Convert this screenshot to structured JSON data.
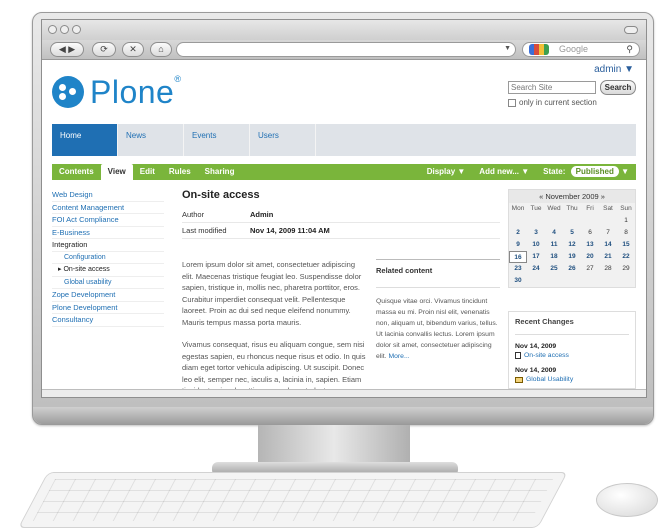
{
  "browser": {
    "search_placeholder": "Google"
  },
  "site": {
    "admin_label": "admin ▼",
    "logo_text": "Plone",
    "logo_mark": "®",
    "search_placeholder": "Search Site",
    "search_button": "Search",
    "only_current": "only in current section"
  },
  "globalnav": [
    "Home",
    "News",
    "Events",
    "Users"
  ],
  "edit_bar": {
    "tabs": [
      "Contents",
      "View",
      "Edit",
      "Rules",
      "Sharing"
    ],
    "display": "Display ▼",
    "add_new": "Add new... ▼",
    "state_label": "State:",
    "state_value": "Published",
    "state_arrow": "▼"
  },
  "sidebar": {
    "items": [
      {
        "label": "Web Design"
      },
      {
        "label": "Content Management"
      },
      {
        "label": "FOI Act Compliance"
      },
      {
        "label": "E-Business"
      },
      {
        "label": "Integration"
      },
      {
        "label": "Configuration"
      },
      {
        "label": "▸ On-site access"
      },
      {
        "label": "Global usability"
      },
      {
        "label": "Zope Development"
      },
      {
        "label": "Plone Development"
      },
      {
        "label": "Consultancy"
      }
    ]
  },
  "main": {
    "title": "On-site access",
    "author_label": "Author",
    "author_value": "Admin",
    "modified_label": "Last modified",
    "modified_value": "Nov 14, 2009 11:04 AM",
    "para1": "Lorem ipsum dolor sit amet, consectetuer adipiscing elit. Maecenas tristique feugiat leo. Suspendisse dolor sapien, tristique in, mollis nec, pharetra porttitor, eros. Curabitur imperdiet consequat velit. Pellentesque laoreet. Proin ac dui sed neque eleifend nonummy. Mauris tempus massa porta mauris.",
    "para2": "Vivamus consequat, risus eu aliquam congue, sem nisi egestas sapien, eu rhoncus neque risus et odio. In quis diam eget tortor vehicula adipiscing. Ut suscipit. Donec leo elit, semper nec, iaculis a, lacinia in, sapien. Etiam tincidunt, mi sed mattis commodo, ante lectus ornare nulla, pellentesque mollis elit"
  },
  "related": {
    "title": "Related content",
    "text": "Quisque vitae orci. Vivamus tincidunt massa eu mi. Proin nisl elit, venenatis non, aliquam ut, bibendum varius, tellus. Ut lacinia convallis lectus. Lorem ipsum dolor sit amet, consectetuer adipiscing elit.",
    "more": "More..."
  },
  "calendar": {
    "header": "« November 2009 »",
    "daynames": [
      "Mon",
      "Tue",
      "Wed",
      "Thu",
      "Fri",
      "Sat",
      "Sun"
    ],
    "rows": [
      [
        "",
        "",
        "",
        "",
        "",
        "",
        "1"
      ],
      [
        "2",
        "3",
        "4",
        "5",
        "6",
        "7",
        "8"
      ],
      [
        "9",
        "10",
        "11",
        "12",
        "13",
        "14",
        "15"
      ],
      [
        "16",
        "17",
        "18",
        "19",
        "20",
        "21",
        "22"
      ],
      [
        "23",
        "24",
        "25",
        "26",
        "27",
        "28",
        "29"
      ],
      [
        "30",
        "",
        "",
        "",
        "",
        "",
        ""
      ]
    ],
    "bold_days": [
      "2",
      "3",
      "4",
      "5",
      "9",
      "10",
      "11",
      "12",
      "13",
      "14",
      "15",
      "16",
      "17",
      "18",
      "19",
      "20",
      "21",
      "22",
      "23",
      "24",
      "25",
      "26",
      "30"
    ],
    "today": "16"
  },
  "recent": {
    "title": "Recent Changes",
    "items": [
      {
        "date": "Nov 14, 2009",
        "label": "On-site access",
        "icon": "document-icon"
      },
      {
        "date": "Nov 14, 2009",
        "label": "Global Usability",
        "icon": "folder-icon"
      }
    ]
  },
  "colors": {
    "brand_blue": "#1f84c8",
    "nav_blue": "#1f6fb3",
    "edit_green": "#7ab53b"
  }
}
